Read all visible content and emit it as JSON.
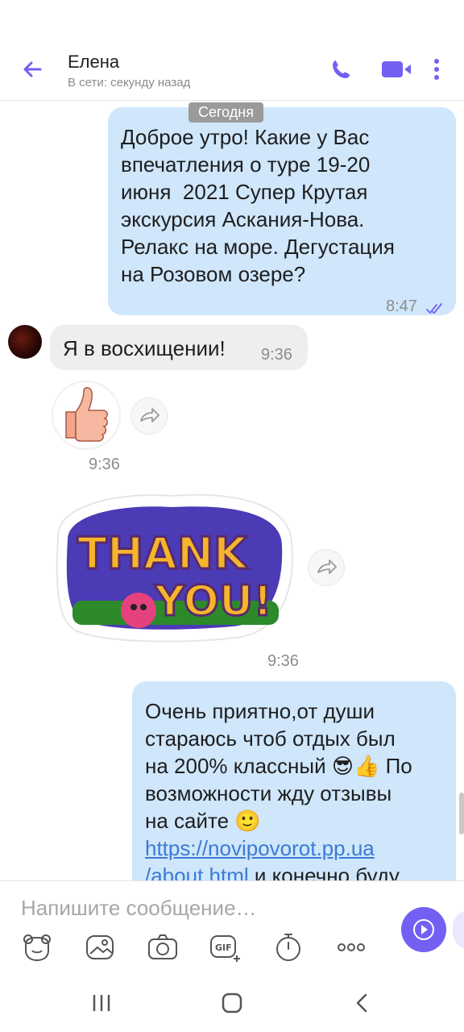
{
  "header": {
    "contact_name": "Елена",
    "status": "В сети: секунду назад",
    "accent_color": "#7360f2",
    "icons": [
      "back-arrow-icon",
      "phone-icon",
      "video-call-icon",
      "more-vertical-icon"
    ]
  },
  "chat": {
    "date_label": "Сегодня",
    "messages": [
      {
        "direction": "outgoing",
        "lines": [
          "Доброе утро! Какие у Вас",
          "впечатления о туре 19-20",
          "июня  2021 Супер Крутая",
          "экскурсия Аскания-Нова.",
          "Релакс на море. Дегустация",
          "на Розовом озере?"
        ],
        "time": "8:47",
        "status_icon": "double-check-icon"
      },
      {
        "direction": "incoming",
        "text": "Я в восхищении!",
        "time": "9:36"
      },
      {
        "direction": "incoming",
        "sticker": "thumbs-up-sticker",
        "time": "9:36"
      },
      {
        "direction": "incoming",
        "sticker": "thank-you-sticker",
        "sticker_text_1": "THANK",
        "sticker_text_2": "YOU!",
        "time": "9:36"
      },
      {
        "direction": "outgoing",
        "lines": [
          "Очень приятно,от души",
          "стараюсь чтоб отдых был",
          "на 200% классный",
          "возможности жду отзывы",
          "на сайте"
        ],
        "line3_suffix": "По",
        "emoji_1": "😎",
        "emoji_2": "👍",
        "emoji_3": "🙂",
        "link_line_1": "https://novipovorot.pp.ua",
        "link_line_2": "/about.html",
        "after_link": " и конечно буду"
      }
    ]
  },
  "composer": {
    "placeholder": "Напишите сообщение…",
    "tools": [
      "sticker-icon",
      "gallery-icon",
      "camera-icon",
      "gif-icon",
      "timer-icon",
      "more-horizontal-icon"
    ],
    "gif_label": "GIF"
  },
  "system_nav": [
    "recent-apps-icon",
    "home-icon",
    "back-icon"
  ]
}
